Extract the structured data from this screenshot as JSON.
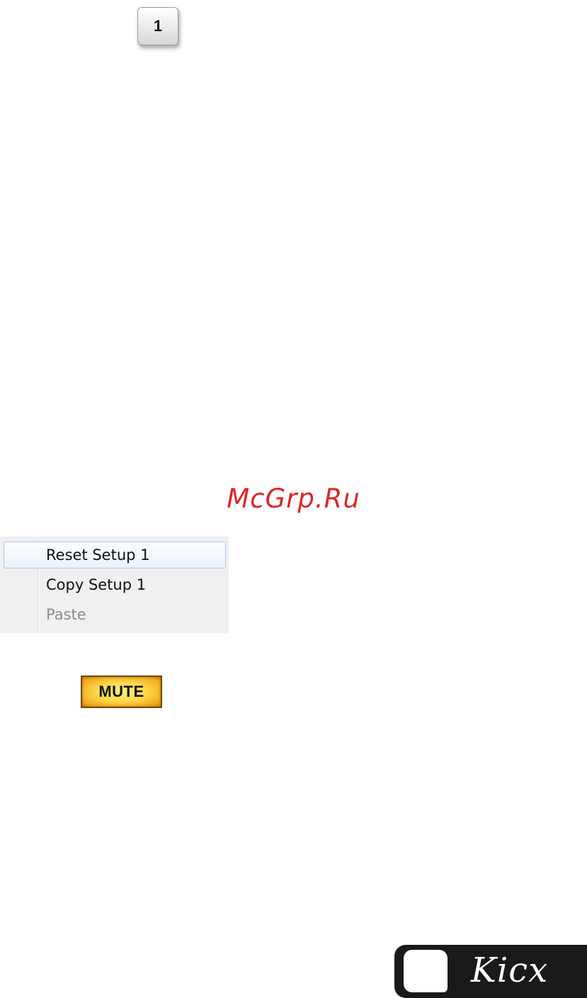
{
  "setup_button": {
    "label": "1"
  },
  "watermark": {
    "text": "McGrp.Ru",
    "color": "#dc2727"
  },
  "context_menu": {
    "items": [
      {
        "label": "Reset Setup 1",
        "state": "highlighted"
      },
      {
        "label": "Copy Setup 1",
        "state": "enabled"
      },
      {
        "label": "Paste",
        "state": "disabled"
      }
    ]
  },
  "mute_button": {
    "label": "MUTE",
    "color": "#ffd84a"
  },
  "logo": {
    "text": "Kicx"
  }
}
